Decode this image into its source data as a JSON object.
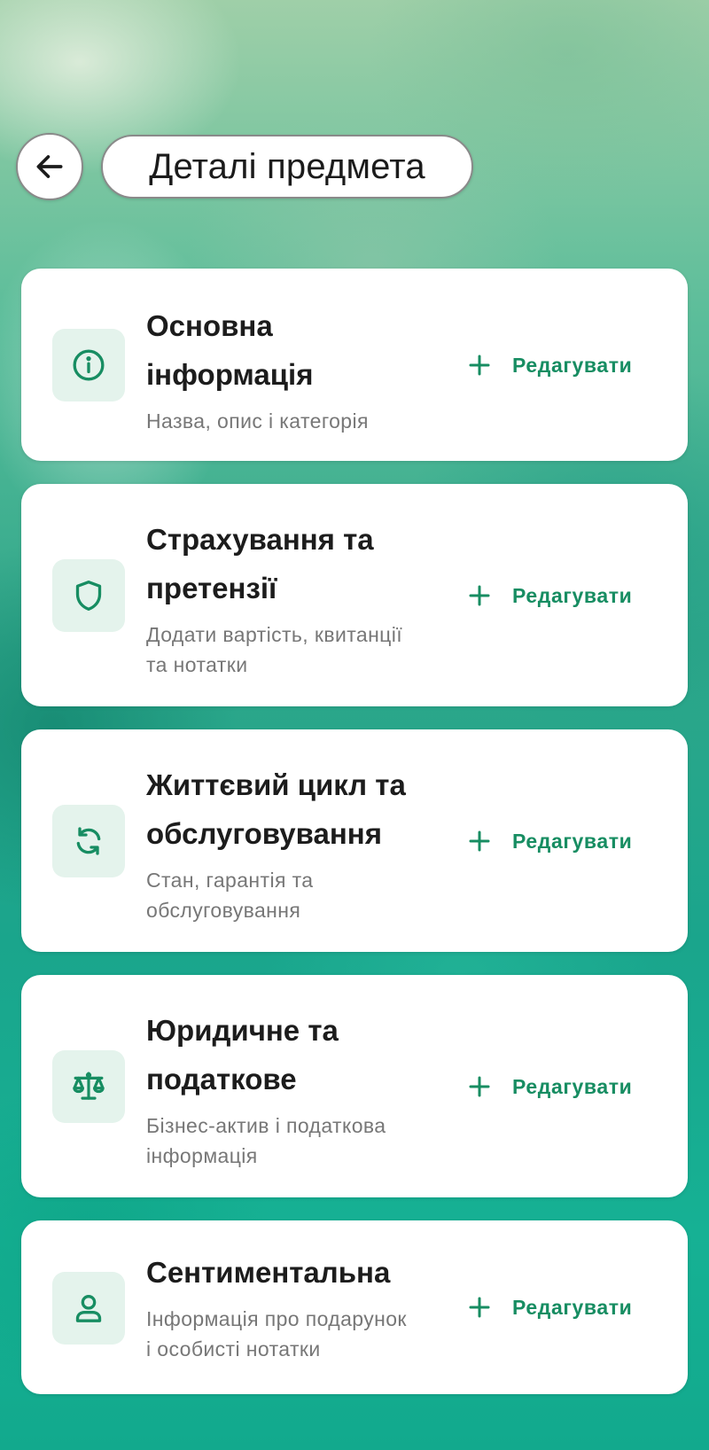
{
  "header": {
    "title": "Деталі предмета",
    "back_icon": "arrow-left-icon"
  },
  "accent_color": "#178d62",
  "sections": [
    {
      "title_lines": [
        "Основна",
        "інформація"
      ],
      "subtitle_lines": [
        "Назва, опис і категорія"
      ],
      "icon": "info-icon",
      "action": "Редагувати"
    },
    {
      "title_lines": [
        "Страхування та",
        "претензії"
      ],
      "subtitle_lines": [
        "Додати вартість, квитанції",
        "та нотатки"
      ],
      "icon": "shield-icon",
      "action": "Редагувати"
    },
    {
      "title_lines": [
        "Життєвий цикл та",
        "обслуговування"
      ],
      "subtitle_lines": [
        "Стан, гарантія та",
        "обслуговування"
      ],
      "icon": "refresh-icon",
      "action": "Редагувати"
    },
    {
      "title_lines": [
        "Юридичне та",
        "податкове"
      ],
      "subtitle_lines": [
        "Бізнес-актив і податкова",
        "інформація"
      ],
      "icon": "scales-icon",
      "action": "Редагувати"
    },
    {
      "title_lines": [
        "Сентиментальна"
      ],
      "subtitle_lines": [
        "Інформація про подарунок",
        "і особисті нотатки"
      ],
      "icon": "person-icon",
      "action": "Редагувати"
    }
  ]
}
